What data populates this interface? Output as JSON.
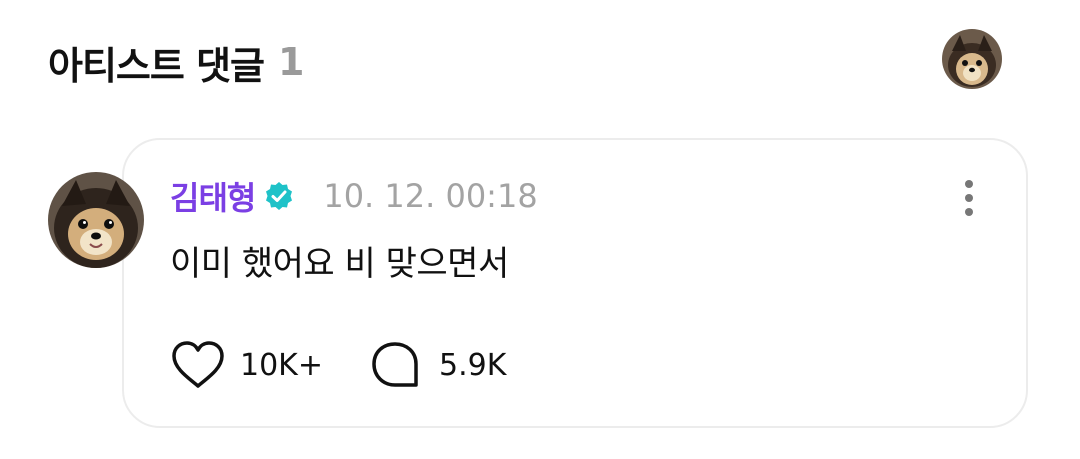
{
  "header": {
    "title": "아티스트 댓글",
    "count": "1"
  },
  "comment": {
    "author": "김태형",
    "verified_icon": "verified-badge-icon",
    "timestamp": "10. 12. 00:18",
    "text": "이미 했어요 비 맞으면서",
    "likes": "10K+",
    "replies": "5.9K"
  },
  "colors": {
    "author": "#7b3fe4",
    "verified": "#1ec2c8",
    "muted": "#a3a3a3",
    "border": "#ececec"
  }
}
